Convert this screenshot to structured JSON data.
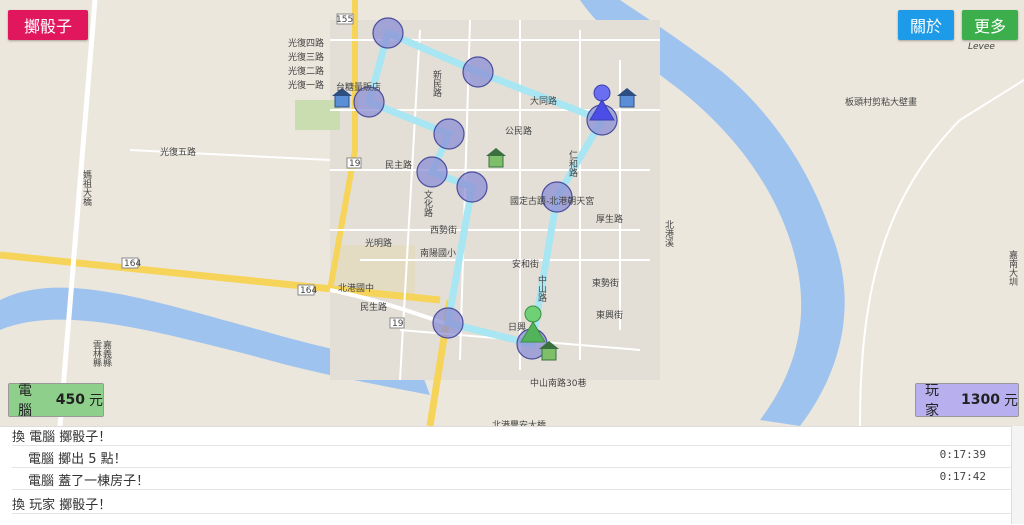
{
  "buttons": {
    "roll": "擲骰子",
    "about": "關於",
    "more": "更多"
  },
  "computer": {
    "label": "電腦",
    "amount": "450",
    "unit": "元",
    "color": "#8fcf8c"
  },
  "player": {
    "label": "玩家",
    "amount": "1300",
    "unit": "元",
    "color": "#b8b0ee"
  },
  "log": [
    {
      "text": "換 電腦 擲骰子！",
      "time": "",
      "indent": false
    },
    {
      "text": "電腦 擲出 5 點！",
      "time": "0:17:39",
      "indent": true
    },
    {
      "text": "電腦 蓋了一棟房子！",
      "time": "0:17:42",
      "indent": true
    },
    {
      "text": "換 玩家 擲骰子！",
      "time": "",
      "indent": false
    }
  ],
  "map_labels": {
    "l1": "光復四路",
    "l2": "光復三路",
    "l3": "光復二路",
    "l4": "光復一路",
    "l5": "台糖量販店",
    "l6": "光復五路",
    "l7": "文化路",
    "l8": "民主路",
    "l9": "光明路",
    "l10": "北港國中",
    "l11": "民生路",
    "l12": "南陽國小",
    "l13": "西勢街",
    "l14": "國定古蹟-北港朝天宮",
    "l15": "厚生路",
    "l16": "安和街",
    "l17": "中山路",
    "l18": "東勢街",
    "l19": "東興街",
    "l20": "中山南路30巷",
    "l21": "北港豐安大橋",
    "l22": "板頭村剪粘大壁畫",
    "l23": "Levee",
    "l24": "大同路",
    "l25": "公民路",
    "l26": "仁和路",
    "l27": "媽祖大橋",
    "l28": "嘉南大圳",
    "l29": "北港溪",
    "l30": "雲林縣",
    "l31": "嘉義縣",
    "l32": "新民路",
    "l33": "日興"
  },
  "route_numbers": [
    "155",
    "19",
    "164",
    "164",
    "19",
    "19",
    "18"
  ],
  "colors": {
    "route": "#a7e6f2",
    "node_fill": "#8b8fd6",
    "node_stroke": "#4a4d9c",
    "player_piece": "#4b4ee6",
    "computer_piece": "#52b35a"
  }
}
